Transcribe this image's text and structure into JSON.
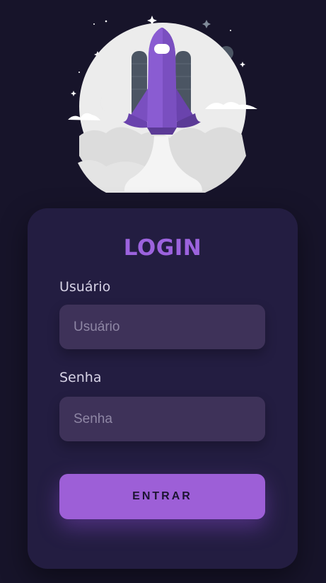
{
  "login": {
    "title": "LOGIN",
    "username_label": "Usuário",
    "username_placeholder": "Usuário",
    "username_value": "",
    "password_label": "Senha",
    "password_placeholder": "Senha",
    "password_value": "",
    "submit_label": "ENTRAR"
  },
  "illustration": {
    "name": "rocket-launch-illustration",
    "colors": {
      "background": "#17142a",
      "card": "#231d41",
      "accent": "#9c63de",
      "button": "#9d5fd7",
      "input": "#3e3259"
    }
  }
}
